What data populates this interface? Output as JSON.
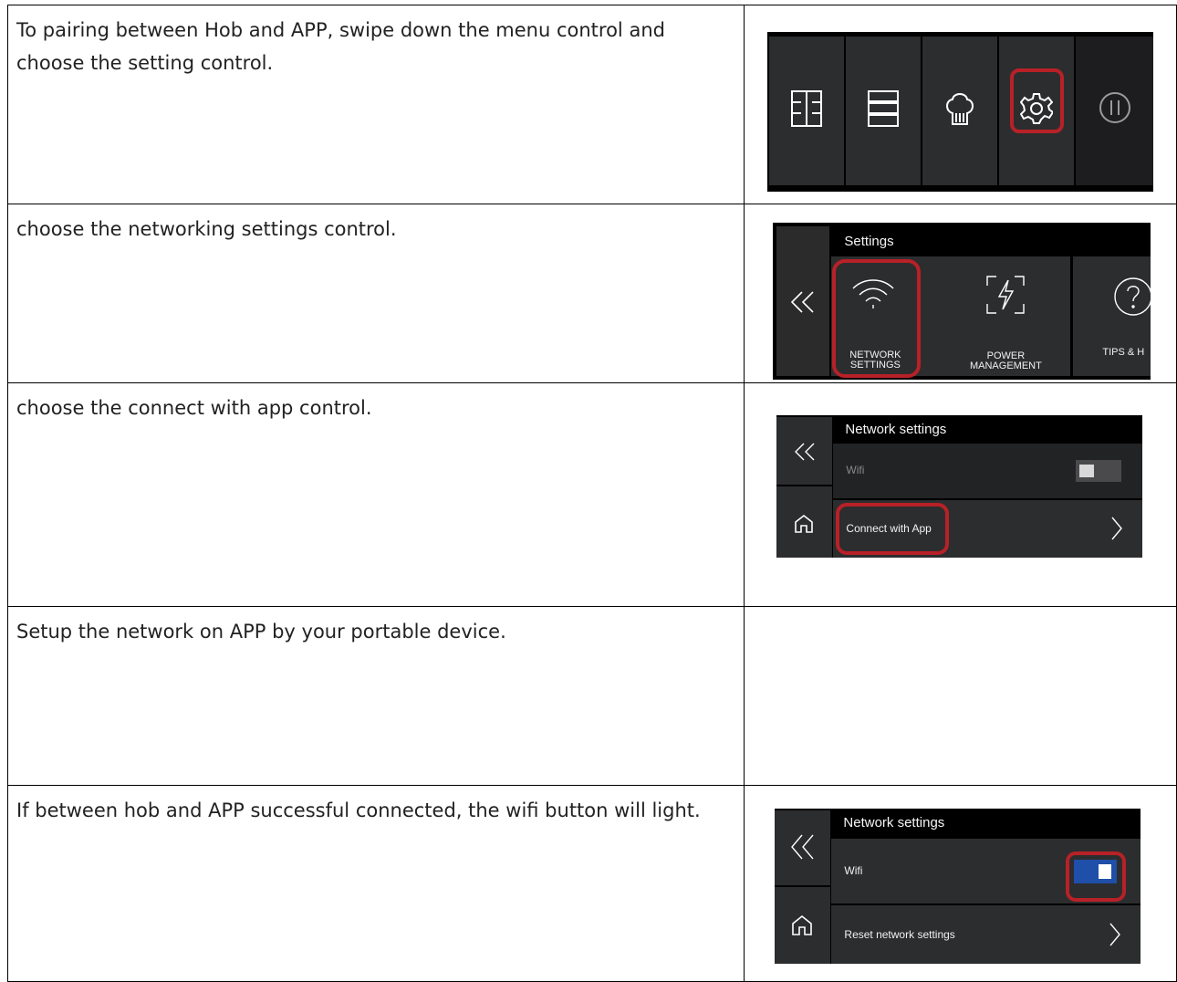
{
  "rows": [
    {
      "text": "To pairing between Hob and APP, swipe down the menu control and choose the setting control."
    },
    {
      "text": "choose the networking settings control."
    },
    {
      "text": "choose the connect with app control."
    },
    {
      "text": "Setup the network on APP by your portable device."
    },
    {
      "text": "If between hob and APP successful connected, the wifi button will light."
    }
  ],
  "menu_screen": {
    "icons": [
      "zone-icon",
      "list-icon",
      "chef-hat-icon",
      "gear-icon",
      "pause-icon"
    ],
    "highlighted": "gear-icon"
  },
  "settings_screen": {
    "title": "Settings",
    "tiles": [
      {
        "label_line1": "NETWORK",
        "label_line2": "SETTINGS",
        "icon": "wifi-icon"
      },
      {
        "label_line1": "POWER",
        "label_line2": "MANAGEMENT",
        "icon": "power-management-icon"
      },
      {
        "label_line1": "TIPS & H",
        "label_line2": "",
        "icon": "help-icon"
      }
    ],
    "highlighted": "NETWORK SETTINGS"
  },
  "network_screen_1": {
    "title": "Network settings",
    "wifi_label": "Wifi",
    "wifi_on": false,
    "connect_label": "Connect with App",
    "highlighted": "Connect with App"
  },
  "network_screen_2": {
    "title": "Network settings",
    "wifi_label": "Wifi",
    "wifi_on": true,
    "reset_label": "Reset network settings",
    "highlighted": "wifi toggle"
  },
  "colors": {
    "highlight": "#b72127",
    "toggle_on": "#1f4fa8",
    "tile": "#2c2d2f"
  }
}
